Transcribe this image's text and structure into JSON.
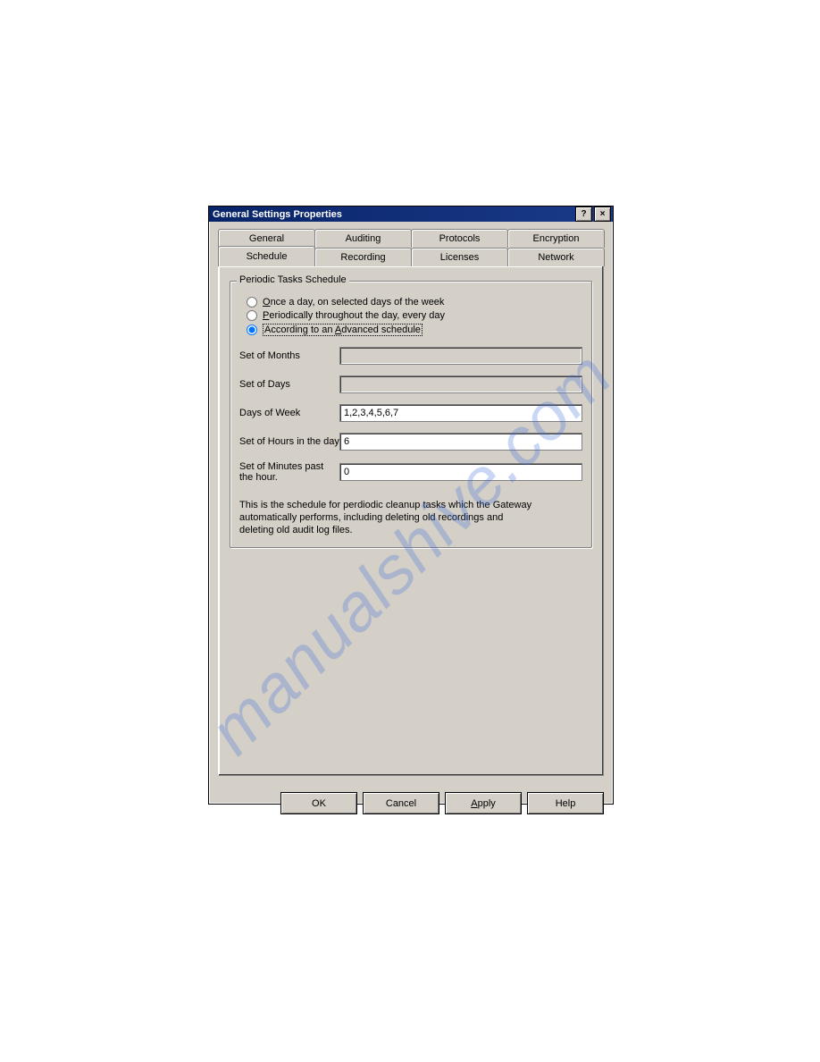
{
  "watermark": "manualshive.com",
  "dialog": {
    "title": "General Settings Properties",
    "help_btn": "?",
    "close_btn": "×"
  },
  "tabs_back": {
    "general": "General",
    "auditing": "Auditing",
    "protocols": "Protocols",
    "encryption": "Encryption"
  },
  "tabs_front": {
    "schedule": "Schedule",
    "recording": "Recording",
    "licenses": "Licenses",
    "network": "Network"
  },
  "group": {
    "legend": "Periodic Tasks Schedule",
    "radio1_pre": "O",
    "radio1_rest": "nce a day, on selected days of the week",
    "radio2_pre": "P",
    "radio2_rest": "eriodically throughout the day, every day",
    "radio3_pre": "According to an ",
    "radio3_u": "A",
    "radio3_post": "dvanced schedule",
    "lab_months": "Set of Months",
    "lab_days": "Set of Days",
    "lab_dow": "Days of Week",
    "lab_hours": "Set of Hours in the day",
    "lab_minutes": "Set of Minutes past the hour.",
    "val_months": "",
    "val_days": "",
    "val_dow": "1,2,3,4,5,6,7",
    "val_hours": "6",
    "val_minutes": "0",
    "description": "This is the schedule for perdiodic cleanup tasks which the Gateway automatically performs, including deleting old recordings and deleting old audit log files."
  },
  "buttons": {
    "ok": "OK",
    "cancel": "Cancel",
    "apply_u": "A",
    "apply_rest": "pply",
    "help": "Help"
  }
}
